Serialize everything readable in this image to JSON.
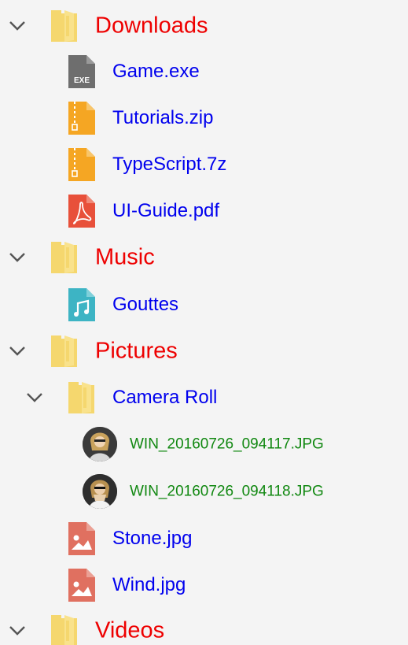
{
  "colors": {
    "top_folder_text": "#ee0000",
    "item_text": "#0000ee",
    "photo_text": "#118811",
    "folder_icon": "#f5d76e",
    "exe_icon": "#6e6e6e",
    "zip_icon": "#f5a623",
    "pdf_icon": "#e8503a",
    "audio_icon": "#3db4c4",
    "image_icon": "#e07060",
    "chevron": "#555555"
  },
  "tree": {
    "downloads": {
      "label": "Downloads",
      "icon": "folder-icon",
      "expanded": true,
      "children": [
        {
          "label": "Game.exe",
          "icon": "exe-file-icon",
          "icon_text": "EXE"
        },
        {
          "label": "Tutorials.zip",
          "icon": "zip-file-icon"
        },
        {
          "label": "TypeScript.7z",
          "icon": "zip-file-icon"
        },
        {
          "label": "UI-Guide.pdf",
          "icon": "pdf-file-icon"
        }
      ]
    },
    "music": {
      "label": "Music",
      "icon": "folder-icon",
      "expanded": true,
      "children": [
        {
          "label": "Gouttes",
          "icon": "audio-file-icon"
        }
      ]
    },
    "pictures": {
      "label": "Pictures",
      "icon": "folder-icon",
      "expanded": true,
      "camera_roll": {
        "label": "Camera Roll",
        "icon": "folder-icon",
        "expanded": true,
        "children": [
          {
            "label": "WIN_20160726_094117.JPG",
            "icon": "photo-thumbnail"
          },
          {
            "label": "WIN_20160726_094118.JPG",
            "icon": "photo-thumbnail"
          }
        ]
      },
      "children": [
        {
          "label": "Stone.jpg",
          "icon": "image-file-icon"
        },
        {
          "label": "Wind.jpg",
          "icon": "image-file-icon"
        }
      ]
    },
    "videos": {
      "label": "Videos",
      "icon": "folder-icon",
      "expanded": true
    }
  }
}
